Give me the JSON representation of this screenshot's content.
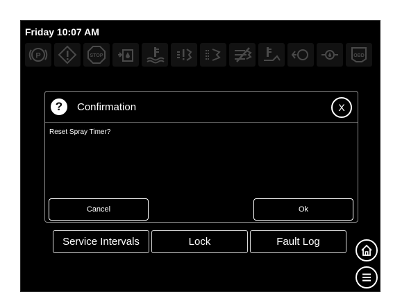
{
  "header": {
    "datetime": "Friday 10:07 AM",
    "status_icons": [
      "parking-brake-icon",
      "warning-icon",
      "stop-icon",
      "fuel-water-icon",
      "coolant-temperature-icon",
      "engine-air-filter-icon",
      "hydraulic-filter-icon",
      "air-restriction-icon",
      "transmission-temperature-icon",
      "oil-pressure-icon",
      "oil-level-icon",
      "obd-icon"
    ]
  },
  "dialog": {
    "title": "Confirmation",
    "message": "Reset Spray Timer?",
    "close_label": "X",
    "cancel_label": "Cancel",
    "ok_label": "Ok"
  },
  "nav": {
    "service_intervals_label": "Service Intervals",
    "lock_label": "Lock",
    "fault_log_label": "Fault Log"
  },
  "colors": {
    "background": "#000000",
    "foreground": "#ffffff",
    "tile": "#121212",
    "icon_dim": "#4a4a4a"
  }
}
